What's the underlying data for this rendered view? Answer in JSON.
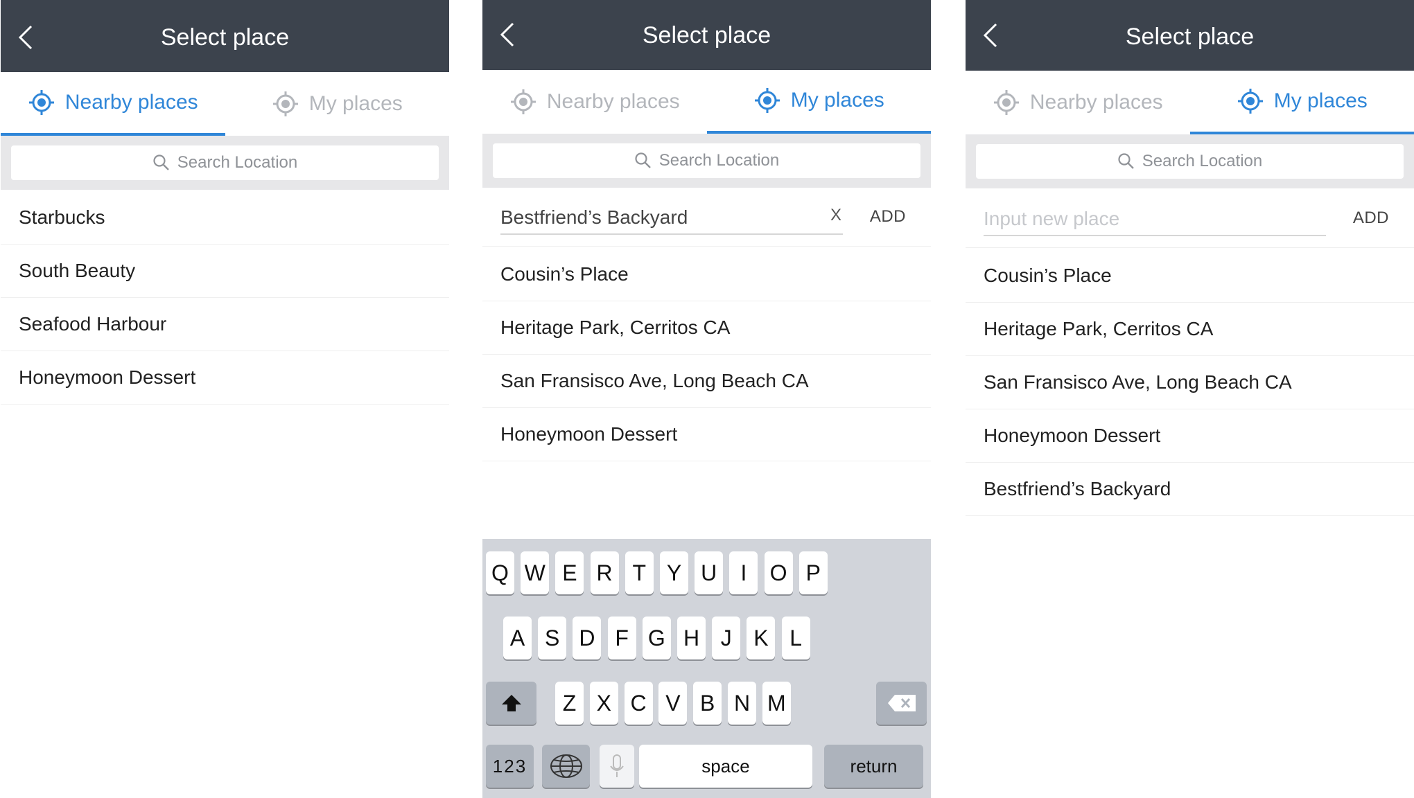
{
  "screens": [
    {
      "title": "Select place",
      "tabs": {
        "nearby": "Nearby places",
        "mine": "My places"
      },
      "active_tab": "nearby",
      "search": {
        "placeholder": "Search Location"
      },
      "places": [
        "Starbucks",
        "South Beauty",
        "Seafood Harbour",
        "Honeymoon Dessert"
      ]
    },
    {
      "title": "Select place",
      "tabs": {
        "nearby": "Nearby places",
        "mine": "My places"
      },
      "active_tab": "mine",
      "search": {
        "placeholder": "Search Location"
      },
      "new_place": {
        "value": "Bestfriend’s Backyard",
        "clear_label": "X",
        "add_label": "ADD"
      },
      "places": [
        "Cousin’s Place",
        "Heritage Park, Cerritos CA",
        "San Fransisco Ave, Long Beach CA",
        "Honeymoon Dessert"
      ],
      "keyboard": {
        "row1": [
          "Q",
          "W",
          "E",
          "R",
          "T",
          "Y",
          "U",
          "I",
          "O",
          "P"
        ],
        "row2": [
          "A",
          "S",
          "D",
          "F",
          "G",
          "H",
          "J",
          "K",
          "L"
        ],
        "row3": [
          "Z",
          "X",
          "C",
          "V",
          "B",
          "N",
          "M"
        ],
        "numbers_label": "123",
        "space_label": "space",
        "return_label": "return"
      }
    },
    {
      "title": "Select place",
      "tabs": {
        "nearby": "Nearby places",
        "mine": "My places"
      },
      "active_tab": "mine",
      "search": {
        "placeholder": "Search Location"
      },
      "new_place": {
        "placeholder": "Input new place",
        "add_label": "ADD"
      },
      "places": [
        "Cousin’s Place",
        "Heritage Park, Cerritos CA",
        "San Fransisco Ave, Long Beach CA",
        "Honeymoon Dessert",
        "Bestfriend’s Backyard"
      ]
    }
  ],
  "colors": {
    "header": "#3c434d",
    "accent": "#2f86d8",
    "inactive": "#b3b6bb",
    "search_bar_bg": "#e7e7e9",
    "keyboard_bg": "#d1d4da"
  }
}
